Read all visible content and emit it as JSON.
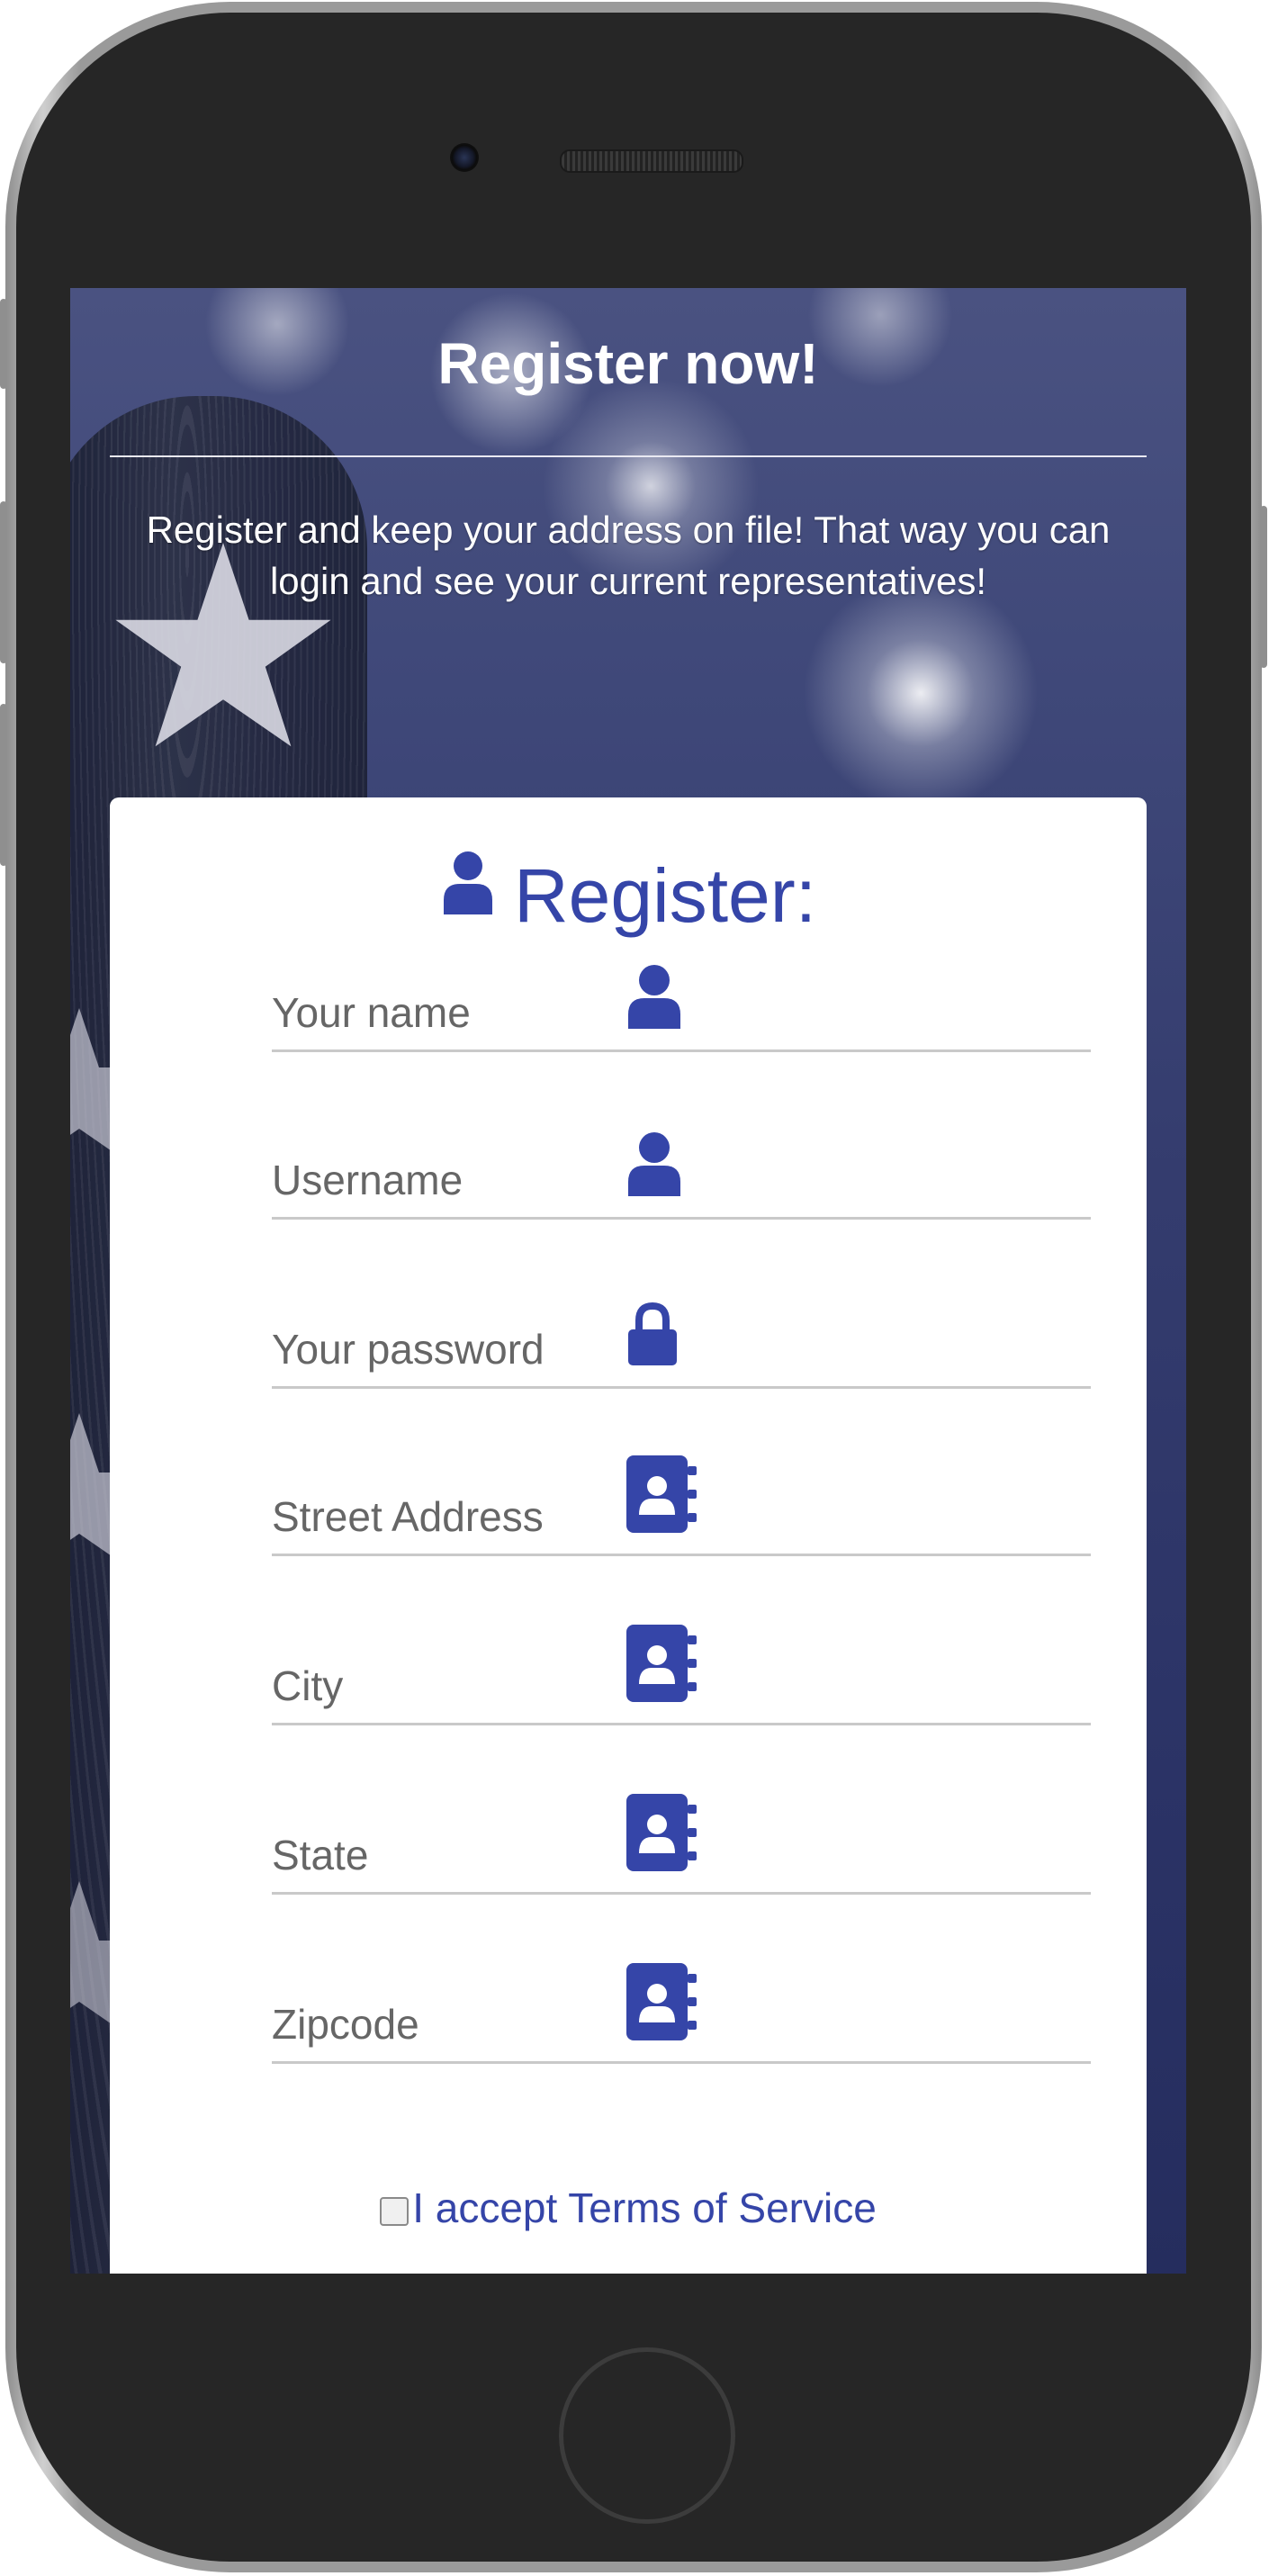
{
  "hero": {
    "title": "Register now!",
    "subtitle": "Register and keep your address on file! That way you can login and see your current representatives!"
  },
  "card": {
    "title": "Register:",
    "title_icon": "user-icon"
  },
  "fields": [
    {
      "label": "Your name",
      "icon": "user-icon"
    },
    {
      "label": "Username",
      "icon": "user-icon"
    },
    {
      "label": "Your password",
      "icon": "lock-icon"
    },
    {
      "label": "Street Address",
      "icon": "address-book-icon"
    },
    {
      "label": "City",
      "icon": "address-book-icon"
    },
    {
      "label": "State",
      "icon": "address-book-icon"
    },
    {
      "label": "Zipcode",
      "icon": "address-book-icon"
    }
  ],
  "tos": {
    "label": "I accept Terms of Service",
    "checked": false
  },
  "colors": {
    "accent": "#3545a8",
    "background_navy": "#2b3366",
    "field_label": "#666666",
    "field_rule": "#c9c9c9"
  }
}
